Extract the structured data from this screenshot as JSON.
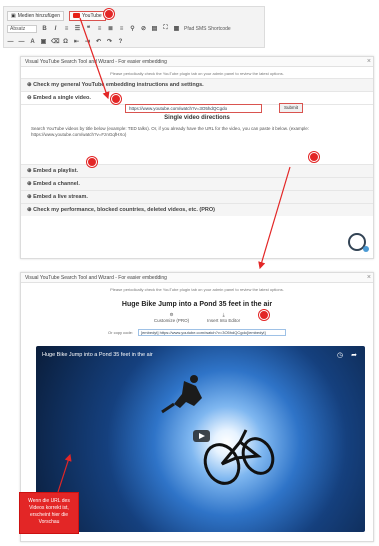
{
  "toolbar": {
    "insert_media_label": "Medien hinzufügen",
    "youtube_label": "YouTube",
    "format_select": "Absatz",
    "bold": "B",
    "italic": "I",
    "list_bullets": "≡",
    "link": "⚲",
    "row3_text_color": "A",
    "row3_extra": "Pfad SMS Shortcode"
  },
  "wizard_top": {
    "title": "Visual YouTube Search Tool and Wizard - For easier embedding",
    "intro": "Please periodically check the YouTube plugin tab on your admin panel to review the latest options.",
    "section_general": "Check my general YouTube embedding instructions and settings.",
    "section_single": "Embed a single video.",
    "directions_title": "Single video directions",
    "directions_text": "Search YouTube videos by title below (example: TED talks). Or, if you already have the URL for the video, you can paste it below. (example: https://www.youtube.com/watch?v=FznGqfHXo)",
    "url_value": "https://www.youtube.com/watch?v=3O5hdQCgdo",
    "submit_label": "Submit",
    "section_playlist": "Embed a playlist.",
    "section_channel": "Embed a channel.",
    "section_live": "Embed a live stream.",
    "section_performance": "Check my performance, blocked countries, deleted videos, etc. (PRO)"
  },
  "wizard_bottom": {
    "title": "Visual YouTube Search Tool and Wizard - For easier embedding",
    "intro": "Please periodically check the YouTube plugin tab on your admin panel to review the latest options.",
    "video_title": "Huge Bike Jump into a Pond 35 feet in the air",
    "option_customize": "Customize (PRO)",
    "option_insert": "Insert Into Editor",
    "copy_label": "Or copy code:",
    "copy_value": "[embedyt] https://www.youtube.com/watch?v=3O5hdQCgdo[/embedyt]"
  },
  "video": {
    "title": "Huge Bike Jump into a Pond 35 feet in the air",
    "clock_icon": "◷",
    "share_icon": "➦"
  },
  "callout": {
    "text": "Wenn die URL des Videos korrekt ist, erscheint hier die Vorschau"
  },
  "colors": {
    "annotation_red": "#e32626",
    "panel_border": "#dcdcdc"
  }
}
